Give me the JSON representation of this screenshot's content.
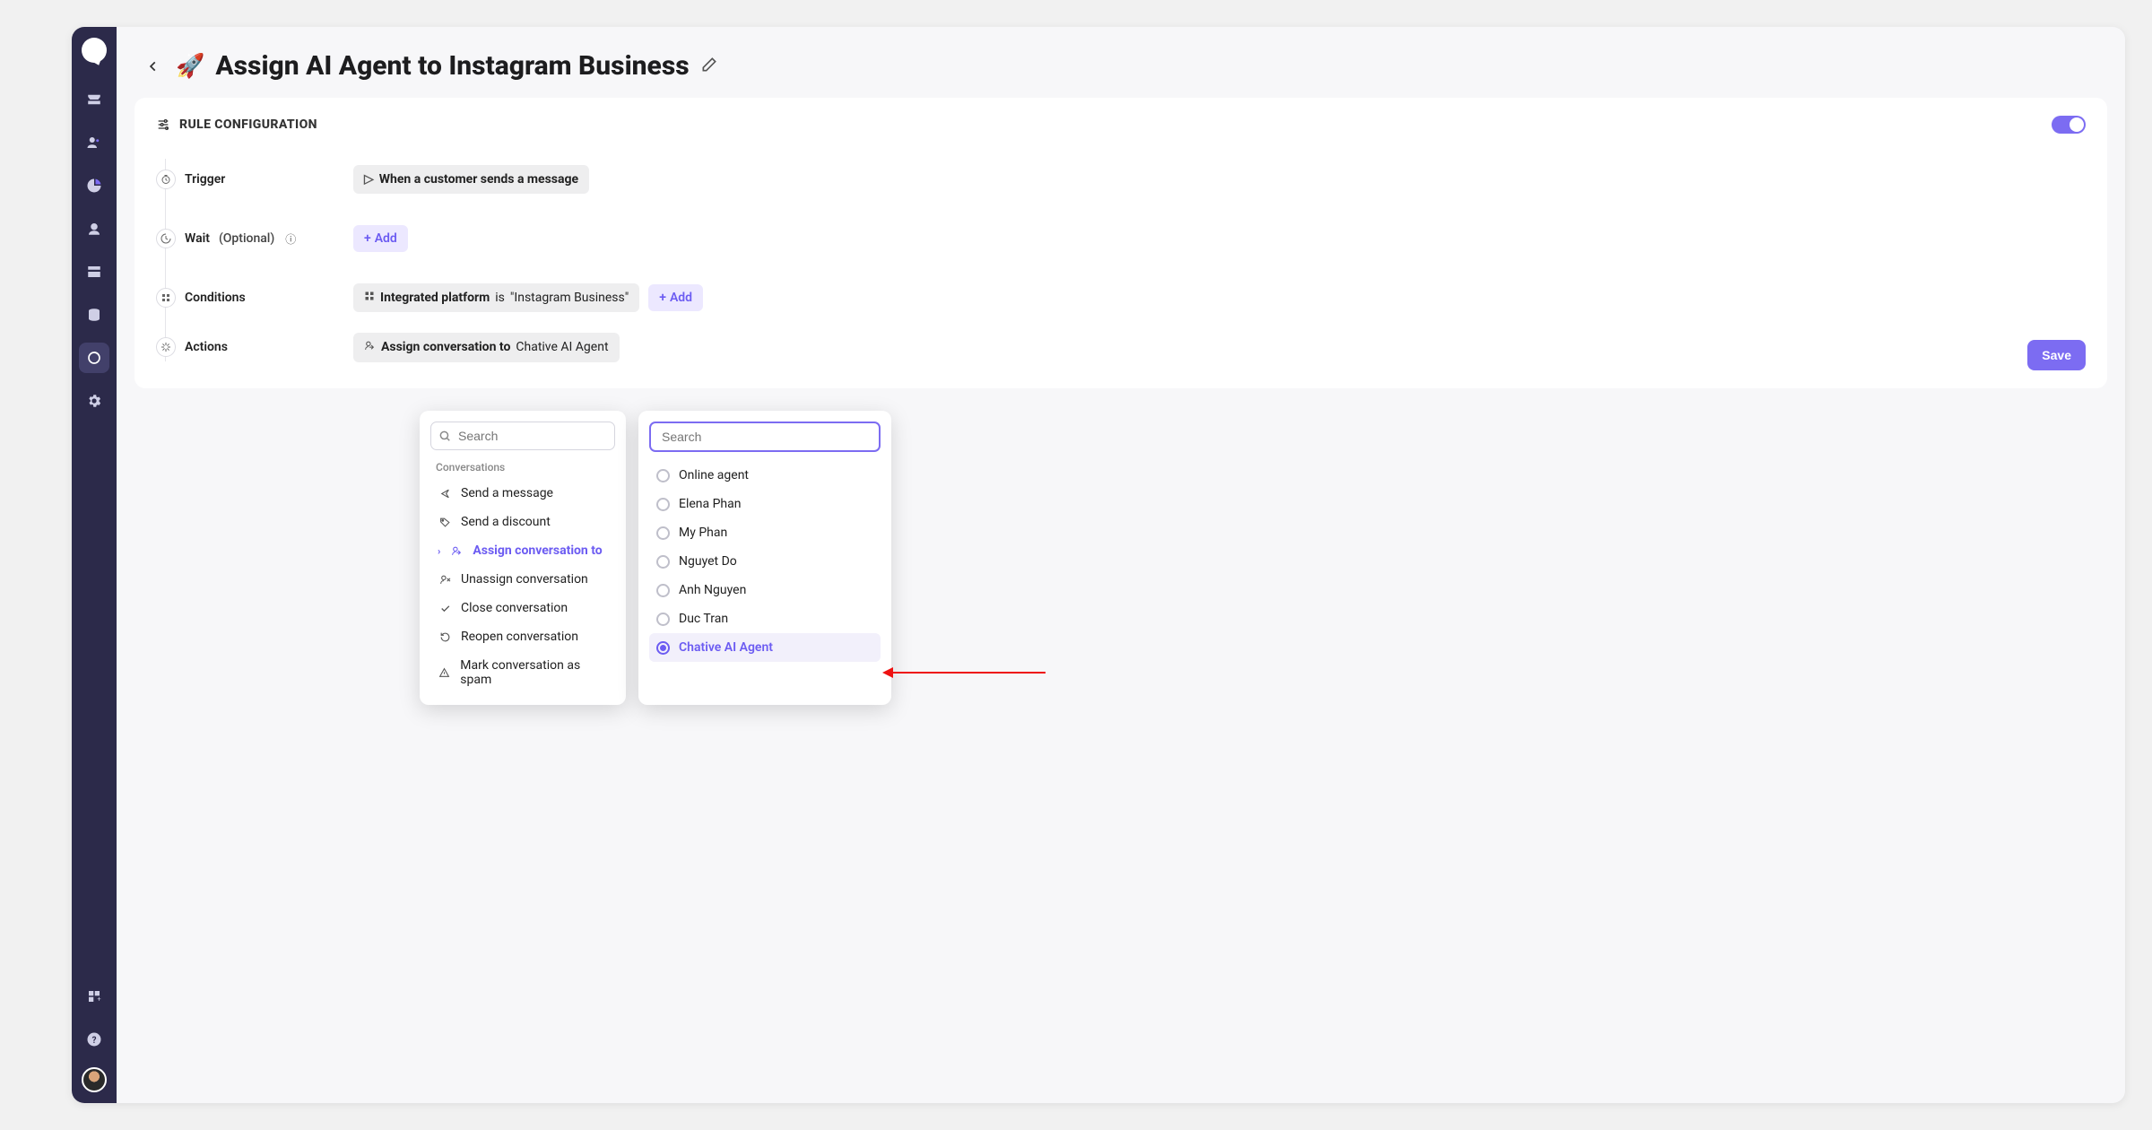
{
  "page": {
    "emoji": "🚀",
    "title": "Assign AI Agent to Instagram Business"
  },
  "config": {
    "section_title": "RULE CONFIGURATION",
    "toggle_on": true
  },
  "timeline": {
    "trigger_label": "Trigger",
    "wait_label": "Wait",
    "wait_suffix": "(Optional)",
    "conditions_label": "Conditions",
    "actions_label": "Actions"
  },
  "trigger": {
    "text": "When a customer sends a message"
  },
  "wait": {
    "add_label": "Add"
  },
  "condition": {
    "field": "Integrated platform",
    "operator": "is",
    "value": "\"Instagram Business\"",
    "add_label": "Add"
  },
  "action": {
    "label": "Assign conversation to",
    "target": "Chative AI Agent"
  },
  "buttons": {
    "save": "Save"
  },
  "panel_left": {
    "search_placeholder": "Search",
    "group": "Conversations",
    "options": [
      {
        "icon": "send",
        "label": "Send a message"
      },
      {
        "icon": "tag",
        "label": "Send a discount"
      },
      {
        "icon": "assign",
        "label": "Assign conversation to",
        "active": true,
        "chevron": true
      },
      {
        "icon": "unassign",
        "label": "Unassign conversation"
      },
      {
        "icon": "check",
        "label": "Close conversation"
      },
      {
        "icon": "reopen",
        "label": "Reopen conversation"
      },
      {
        "icon": "spam",
        "label": "Mark conversation as spam"
      }
    ]
  },
  "panel_right": {
    "search_placeholder": "Search",
    "options": [
      {
        "label": "Online agent",
        "selected": false
      },
      {
        "label": "Elena Phan",
        "selected": false
      },
      {
        "label": "My Phan",
        "selected": false
      },
      {
        "label": "Nguyet Do",
        "selected": false
      },
      {
        "label": "Anh Nguyen",
        "selected": false
      },
      {
        "label": "Duc Tran",
        "selected": false
      },
      {
        "label": "Chative AI Agent",
        "selected": true
      }
    ]
  }
}
